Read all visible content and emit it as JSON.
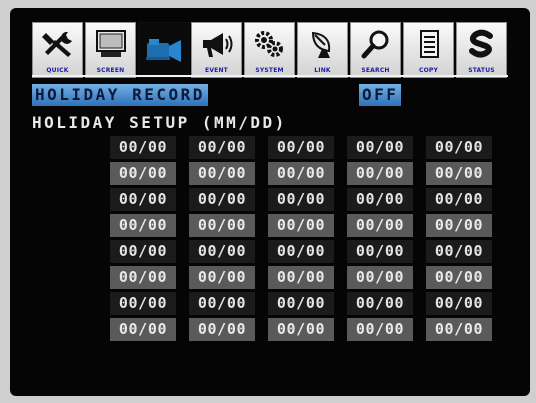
{
  "toolbar": {
    "items": [
      {
        "label": "QUICK",
        "icon": "tools-icon"
      },
      {
        "label": "SCREEN",
        "icon": "monitor-icon"
      },
      {
        "label": "",
        "icon": "camera-icon"
      },
      {
        "label": "EVENT",
        "icon": "megaphone-icon"
      },
      {
        "label": "SYSTEM",
        "icon": "gears-icon"
      },
      {
        "label": "LINK",
        "icon": "satellite-dish-icon"
      },
      {
        "label": "SEARCH",
        "icon": "magnifier-icon"
      },
      {
        "label": "COPY",
        "icon": "document-icon"
      },
      {
        "label": "STATUS",
        "icon": "status-s-icon"
      }
    ],
    "active_index": 2
  },
  "holiday_record": {
    "label": "HOLIDAY RECORD",
    "value": "OFF"
  },
  "holiday_setup": {
    "title": "HOLIDAY SETUP (MM/DD)",
    "rows": [
      [
        "00/00",
        "00/00",
        "00/00",
        "00/00",
        "00/00"
      ],
      [
        "00/00",
        "00/00",
        "00/00",
        "00/00",
        "00/00"
      ],
      [
        "00/00",
        "00/00",
        "00/00",
        "00/00",
        "00/00"
      ],
      [
        "00/00",
        "00/00",
        "00/00",
        "00/00",
        "00/00"
      ],
      [
        "00/00",
        "00/00",
        "00/00",
        "00/00",
        "00/00"
      ],
      [
        "00/00",
        "00/00",
        "00/00",
        "00/00",
        "00/00"
      ],
      [
        "00/00",
        "00/00",
        "00/00",
        "00/00",
        "00/00"
      ],
      [
        "00/00",
        "00/00",
        "00/00",
        "00/00",
        "00/00"
      ]
    ]
  },
  "colors": {
    "highlight": "#4a8fd4",
    "icon_label": "#1a1aa6",
    "background": "#050505"
  }
}
